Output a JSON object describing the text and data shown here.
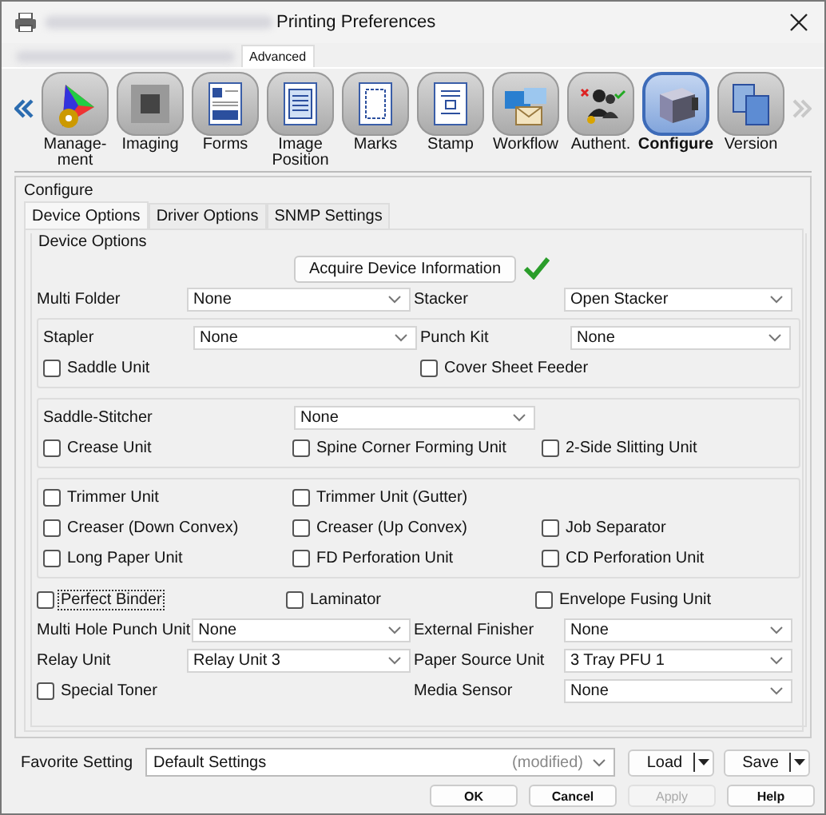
{
  "window": {
    "title": "Printing Preferences"
  },
  "top_tabs": [
    {
      "label": "Advanced",
      "selected": true
    }
  ],
  "toolbar": {
    "scroll_left_enabled": true,
    "scroll_right_enabled": false,
    "items": [
      {
        "label": "Manage-\nment",
        "kind": "gamut",
        "selected": false
      },
      {
        "label": "Imaging",
        "kind": "imaging",
        "selected": false
      },
      {
        "label": "Forms",
        "kind": "forms",
        "selected": false
      },
      {
        "label": "Image\nPosition",
        "kind": "position",
        "selected": false
      },
      {
        "label": "Marks",
        "kind": "marks",
        "selected": false
      },
      {
        "label": "Stamp",
        "kind": "stamp",
        "selected": false
      },
      {
        "label": "Workflow",
        "kind": "workflow",
        "selected": false
      },
      {
        "label": "Authent.",
        "kind": "auth",
        "selected": false
      },
      {
        "label": "Configure",
        "kind": "configure",
        "selected": true
      },
      {
        "label": "Version",
        "kind": "version",
        "selected": false
      }
    ]
  },
  "configure": {
    "title": "Configure",
    "tabs": [
      {
        "label": "Device Options",
        "selected": true
      },
      {
        "label": "Driver Options",
        "selected": false
      },
      {
        "label": "SNMP Settings",
        "selected": false
      }
    ],
    "panel": {
      "title": "Device Options",
      "acquire_button": "Acquire Device Information",
      "acquired": true,
      "rows": [
        {
          "kind": "fields",
          "items": [
            {
              "kind": "select",
              "label": "Multi Folder",
              "value": "None"
            },
            {
              "kind": "select",
              "label": "Stacker",
              "value": "Open Stacker"
            }
          ]
        },
        {
          "kind": "box",
          "rows": [
            {
              "kind": "fields",
              "items": [
                {
                  "kind": "select",
                  "label": "Stapler",
                  "value": "None"
                },
                {
                  "kind": "select",
                  "label": "Punch Kit",
                  "value": "None"
                }
              ]
            },
            {
              "kind": "fields",
              "items": [
                {
                  "kind": "check",
                  "label": "Saddle Unit",
                  "checked": false,
                  "focused": false
                },
                {
                  "kind": "check",
                  "label": "Cover Sheet Feeder",
                  "checked": false,
                  "focused": false
                }
              ]
            }
          ]
        },
        {
          "kind": "box",
          "rows": [
            {
              "kind": "wide_field",
              "items": [
                {
                  "kind": "select",
                  "label": "Saddle-Stitcher",
                  "value": "None"
                }
              ]
            },
            {
              "kind": "checks",
              "items": [
                {
                  "kind": "check",
                  "label": "Crease Unit",
                  "checked": false,
                  "focused": false
                },
                {
                  "kind": "check",
                  "label": "Spine Corner Forming Unit",
                  "checked": false,
                  "focused": false
                },
                {
                  "kind": "check",
                  "label": "2-Side Slitting Unit",
                  "checked": false,
                  "focused": false
                }
              ]
            }
          ]
        },
        {
          "kind": "box",
          "rows": [
            {
              "kind": "checks",
              "items": [
                {
                  "kind": "check",
                  "label": "Trimmer Unit",
                  "checked": false,
                  "focused": false
                },
                {
                  "kind": "check",
                  "label": "Trimmer Unit (Gutter)",
                  "checked": false,
                  "focused": false
                }
              ]
            },
            {
              "kind": "checks",
              "items": [
                {
                  "kind": "check",
                  "label": "Creaser (Down Convex)",
                  "checked": false,
                  "focused": false
                },
                {
                  "kind": "check",
                  "label": "Creaser (Up Convex)",
                  "checked": false,
                  "focused": false
                },
                {
                  "kind": "check",
                  "label": "Job Separator",
                  "checked": false,
                  "focused": false
                }
              ]
            },
            {
              "kind": "checks",
              "items": [
                {
                  "kind": "check",
                  "label": "Long Paper Unit",
                  "checked": false,
                  "focused": false
                },
                {
                  "kind": "check",
                  "label": "FD Perforation Unit",
                  "checked": false,
                  "focused": false
                },
                {
                  "kind": "check",
                  "label": "CD Perforation Unit",
                  "checked": false,
                  "focused": false
                }
              ]
            }
          ]
        },
        {
          "kind": "checks",
          "items": [
            {
              "kind": "check",
              "label": "Perfect Binder",
              "checked": false,
              "focused": true
            },
            {
              "kind": "check",
              "label": "Laminator",
              "checked": false,
              "focused": false
            },
            {
              "kind": "check",
              "label": "Envelope Fusing Unit",
              "checked": false,
              "focused": false
            }
          ]
        },
        {
          "kind": "fields",
          "items": [
            {
              "kind": "select",
              "label": "Multi Hole Punch Unit",
              "value": "None"
            },
            {
              "kind": "select",
              "label": "External Finisher",
              "value": "None"
            }
          ]
        },
        {
          "kind": "fields",
          "items": [
            {
              "kind": "select",
              "label": "Relay Unit",
              "value": "Relay Unit 3"
            },
            {
              "kind": "select",
              "label": "Paper Source Unit",
              "value": "3 Tray PFU 1"
            }
          ]
        },
        {
          "kind": "fields",
          "items": [
            {
              "kind": "check",
              "label": "Special Toner",
              "checked": false,
              "focused": false
            },
            {
              "kind": "select",
              "label": "Media Sensor",
              "value": "None"
            }
          ]
        }
      ]
    }
  },
  "favorite": {
    "label": "Favorite Setting",
    "value": "Default Settings",
    "note": "(modified)",
    "buttons": [
      "Load",
      "Save"
    ]
  },
  "dialog_buttons": [
    {
      "label": "OK",
      "disabled": false
    },
    {
      "label": "Cancel",
      "disabled": false
    },
    {
      "label": "Apply",
      "disabled": true
    },
    {
      "label": "Help",
      "disabled": false
    }
  ]
}
